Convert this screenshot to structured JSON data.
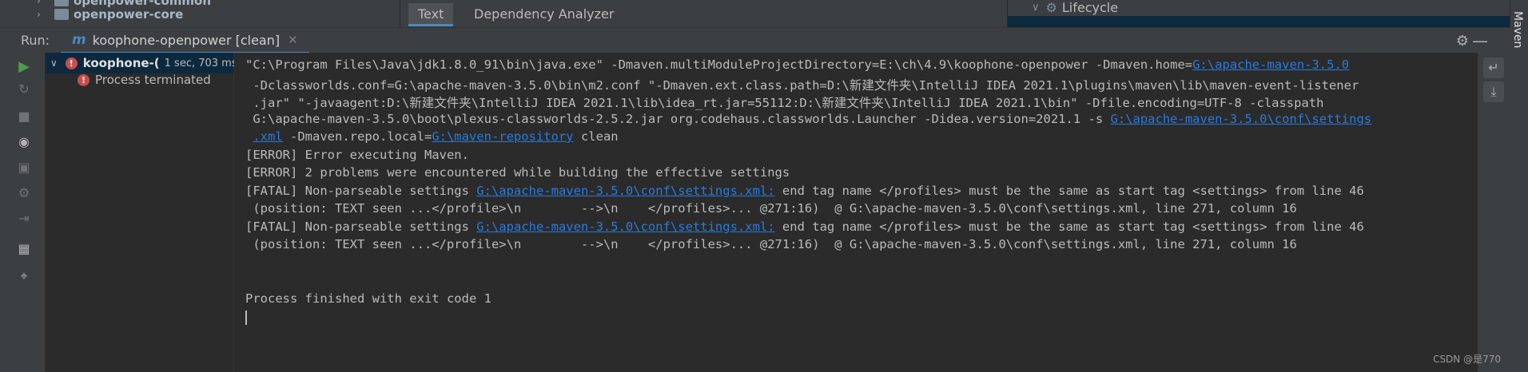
{
  "project": {
    "items": [
      {
        "label": "openpower-common"
      },
      {
        "label": "openpower-core"
      }
    ]
  },
  "editor_tabs": [
    {
      "label": "Text",
      "active": true
    },
    {
      "label": "Dependency Analyzer",
      "active": false
    }
  ],
  "maven_panel": {
    "node_label": "Lifecycle",
    "side_label": "Maven"
  },
  "run_bar": {
    "label": "Run:",
    "tab_icon": "m",
    "tab_label": "koophone-openpower [clean]"
  },
  "run_tree": {
    "root_label": "koophone-(",
    "root_time": "1 sec, 703 ms",
    "child_label": "Process terminated"
  },
  "console": {
    "lines": [
      [
        {
          "t": "\"C:\\Program Files\\Java\\jdk1.8.0_91\\bin\\java.exe\" -Dmaven.multiModuleProjectDirectory=E:\\ch\\4.9\\koophone-openpower -Dmaven.home="
        },
        {
          "t": "G:\\apache-maven-3.5.0",
          "link": true
        }
      ],
      [
        {
          "t": " -Dclassworlds.conf=G:\\apache-maven-3.5.0\\bin\\m2.conf \"-Dmaven.ext.class.path=D:\\新建文件夹\\IntelliJ IDEA 2021.1\\plugins\\maven\\lib\\maven-event-listener"
        }
      ],
      [
        {
          "t": " .jar\" \"-javaagent:D:\\新建文件夹\\IntelliJ IDEA 2021.1\\lib\\idea_rt.jar=55112:D:\\新建文件夹\\IntelliJ IDEA 2021.1\\bin\" -Dfile.encoding=UTF-8 -classpath"
        }
      ],
      [
        {
          "t": " G:\\apache-maven-3.5.0\\boot\\plexus-classworlds-2.5.2.jar org.codehaus.classworlds.Launcher -Didea.version=2021.1 -s "
        },
        {
          "t": "G:\\apache-maven-3.5.0\\conf\\settings",
          "link": true
        }
      ],
      [
        {
          "t": " "
        },
        {
          "t": ".xml",
          "link": true
        },
        {
          "t": " -Dmaven.repo.local="
        },
        {
          "t": "G:\\maven-repository",
          "link": true
        },
        {
          "t": " clean"
        }
      ],
      [
        {
          "t": "[ERROR] Error executing Maven."
        }
      ],
      [
        {
          "t": "[ERROR] 2 problems were encountered while building the effective settings"
        }
      ],
      [
        {
          "t": "[FATAL] Non-parseable settings "
        },
        {
          "t": "G:\\apache-maven-3.5.0\\conf\\settings.xml:",
          "link": true
        },
        {
          "t": " end tag name </profiles> must be the same as start tag <settings> from line 46"
        }
      ],
      [
        {
          "t": " (position: TEXT seen ...</profile>\\n        -->\\n    </profiles>... @271:16)  @ G:\\apache-maven-3.5.0\\conf\\settings.xml, line 271, column 16"
        }
      ],
      [
        {
          "t": "[FATAL] Non-parseable settings "
        },
        {
          "t": "G:\\apache-maven-3.5.0\\conf\\settings.xml:",
          "link": true
        },
        {
          "t": " end tag name </profiles> must be the same as start tag <settings> from line 46"
        }
      ],
      [
        {
          "t": " (position: TEXT seen ...</profile>\\n        -->\\n    </profiles>... @271:16)  @ G:\\apache-maven-3.5.0\\conf\\settings.xml, line 271, column 16"
        }
      ],
      [],
      [],
      [
        {
          "t": "Process finished with exit code 1"
        }
      ]
    ]
  },
  "watermark": "CSDN @是770",
  "colors": {
    "accent": "#4a88c7",
    "link": "#287bde",
    "error": "#c74e4e",
    "run": "#499c54"
  }
}
